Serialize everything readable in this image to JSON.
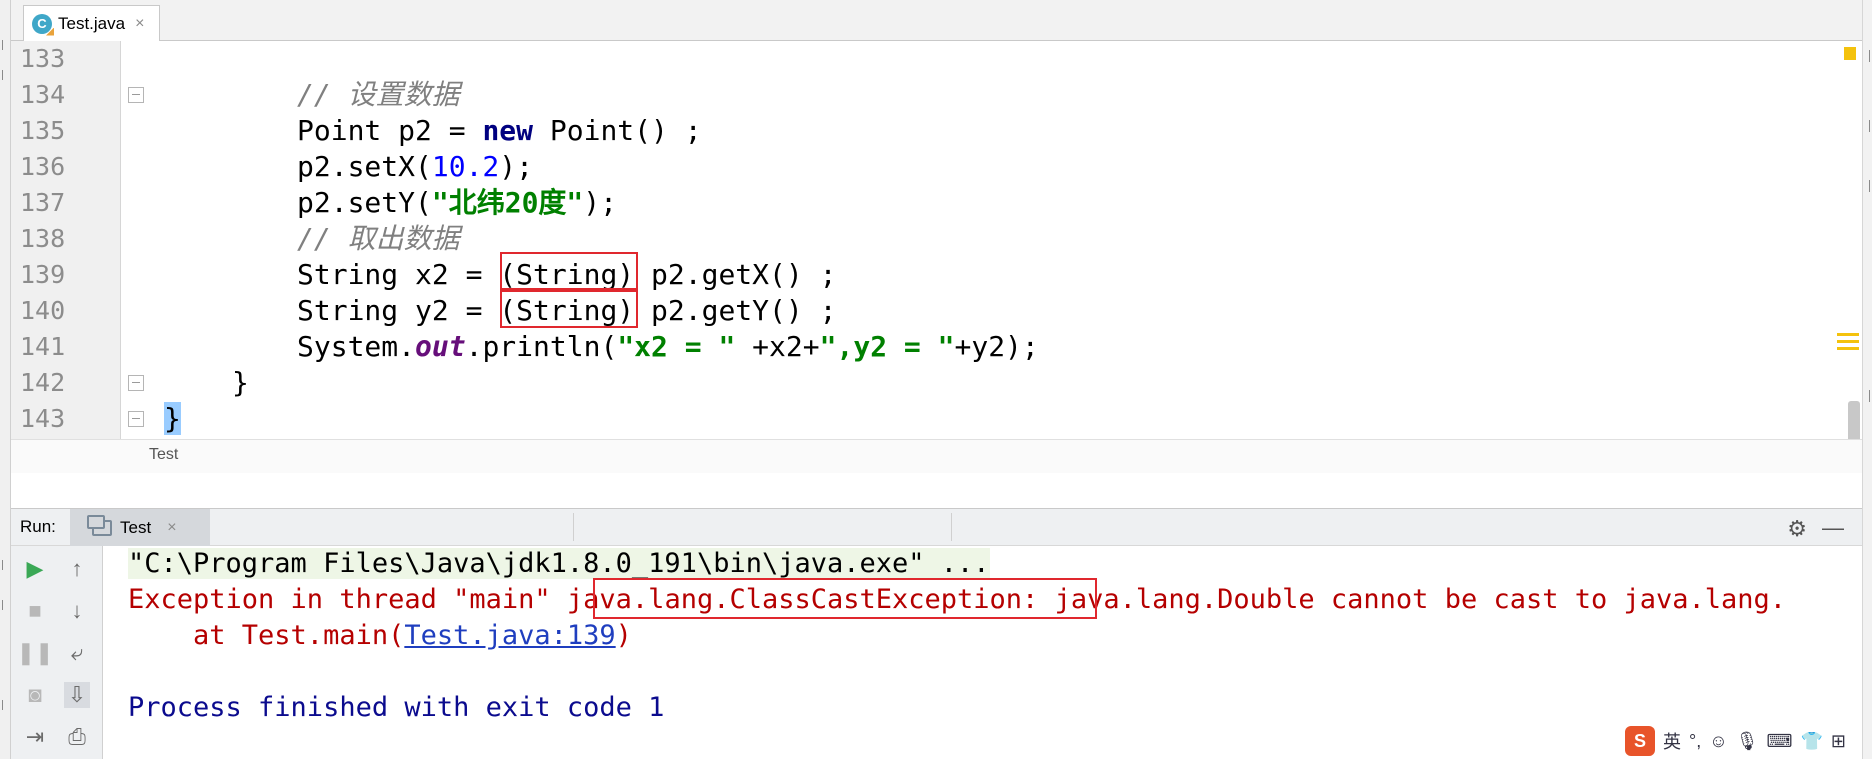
{
  "editor_tab": {
    "label": "Test.java",
    "icon": "class-file-icon",
    "icon_letter": "C",
    "close": "×"
  },
  "gutter": {
    "line_numbers": [
      "133",
      "134",
      "135",
      "136",
      "137",
      "138",
      "139",
      "140",
      "141",
      "142",
      "143"
    ]
  },
  "code": {
    "l134_comment": "// 设置数据",
    "l135_type": "Point p2 = ",
    "l135_new": "new",
    "l135_rest": " Point() ;",
    "l136_pre": "p2.setX(",
    "l136_num": "10.2",
    "l136_post": ");",
    "l137_pre": "p2.setY(",
    "l137_str": "\"北纬20度\"",
    "l137_post": ");",
    "l138_comment": "// 取出数据",
    "l139_pre": "String x2 = ",
    "l139_cast": "(String)",
    "l139_post": " p2.getX() ;",
    "l140_pre": "String y2 = ",
    "l140_cast": "(String)",
    "l140_post": " p2.getY() ;",
    "l141_pre": "System.",
    "l141_field": "out",
    "l141_mid": ".println(",
    "l141_str1": "\"x2 = \"",
    "l141_mid2": " +x2+",
    "l141_str2": "\",y2 = \"",
    "l141_post": "+y2);",
    "l142": "}",
    "l143": "}"
  },
  "breadcrumb": "Test",
  "run_panel": {
    "label": "Run:",
    "tab_label": "Test",
    "tab_close": "×",
    "console": {
      "cmd": "\"C:\\Program Files\\Java\\jdk1.8.0_191\\bin\\java.exe\" ...",
      "err_pre": "Exception in thread \"main\" ",
      "err_exception": "java.lang.ClassCastException:",
      "err_post": " java.lang.Double cannot be cast to java.lang.",
      "at_pre": "    at Test.main(",
      "at_link": "Test.java:139",
      "at_post": ")",
      "exit": "Process finished with exit code 1"
    }
  },
  "ime": {
    "logo": "S",
    "lang": "英"
  },
  "colors": {
    "highlight_box": "#e0282e",
    "error_text": "#b50000",
    "keyword": "#000080",
    "string": "#008000"
  }
}
